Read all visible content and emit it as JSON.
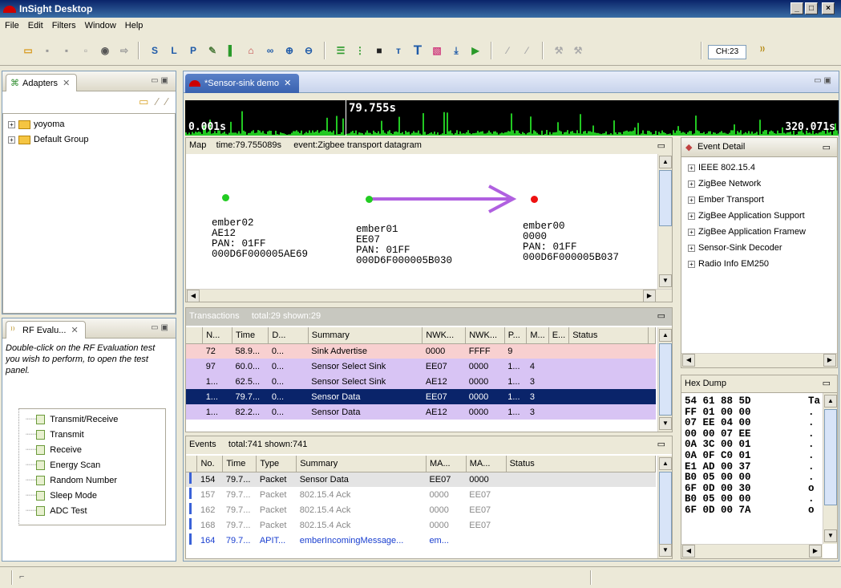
{
  "window": {
    "title": "InSight Desktop",
    "min": "_",
    "max": "□",
    "close": "×"
  },
  "menu": [
    "File",
    "Edit",
    "Filters",
    "Window",
    "Help"
  ],
  "toolbar": {
    "channel": "CH:23"
  },
  "adapters": {
    "tab": "Adapters",
    "items": [
      {
        "label": "yoyoma",
        "expander": "+"
      },
      {
        "label": "Default Group",
        "expander": "+"
      }
    ]
  },
  "rf_eval": {
    "tab": "RF Evalu...",
    "instructions": "Double-click on the RF Evaluation test you wish to perform, to open the test panel.",
    "tests": [
      "Transmit/Receive",
      "Transmit",
      "Receive",
      "Energy Scan",
      "Random Number",
      "Sleep Mode",
      "ADC Test"
    ]
  },
  "editor": {
    "tab": "*Sensor-sink demo",
    "timeline": {
      "cursor_time": "79.755s",
      "start": "0.001s",
      "end": "320.071s"
    }
  },
  "map": {
    "label": "Map",
    "time": "time:79.755089s",
    "event": "event:Zigbee transport datagram",
    "nodes": [
      {
        "name": "ember02",
        "short": "AE12",
        "pan": "PAN: 01FF",
        "eui": "000D6F000005AE69",
        "color": "#22cc22"
      },
      {
        "name": "ember01",
        "short": "EE07",
        "pan": "PAN: 01FF",
        "eui": "000D6F000005B030",
        "color": "#22cc22"
      },
      {
        "name": "ember00",
        "short": "0000",
        "pan": "PAN: 01FF",
        "eui": "000D6F000005B037",
        "color": "#ee1111"
      }
    ]
  },
  "transactions": {
    "title": "Transactions",
    "counts": "total:29 shown:29",
    "columns": [
      "N...",
      "Time",
      "D...",
      "Summary",
      "NWK...",
      "NWK...",
      "P...",
      "M...",
      "E...",
      "Status"
    ],
    "rows": [
      {
        "n": "72",
        "time": "58.9...",
        "d": "0...",
        "summary": "Sink Advertise",
        "nwk1": "0000",
        "nwk2": "FFFF",
        "p": "9",
        "m": "",
        "e": "",
        "status": "",
        "bg": "#f8d0d0",
        "fg": "#000"
      },
      {
        "n": "97",
        "time": "60.0...",
        "d": "0...",
        "summary": "Sensor Select Sink",
        "nwk1": "EE07",
        "nwk2": "0000",
        "p": "1...",
        "m": "4",
        "e": "",
        "status": "",
        "bg": "#d8c4f4",
        "fg": "#000"
      },
      {
        "n": "1...",
        "time": "62.5...",
        "d": "0...",
        "summary": "Sensor Select Sink",
        "nwk1": "AE12",
        "nwk2": "0000",
        "p": "1...",
        "m": "3",
        "e": "",
        "status": "",
        "bg": "#d8c4f4",
        "fg": "#000"
      },
      {
        "n": "1...",
        "time": "79.7...",
        "d": "0...",
        "summary": "Sensor Data",
        "nwk1": "EE07",
        "nwk2": "0000",
        "p": "1...",
        "m": "3",
        "e": "",
        "status": "",
        "bg": "#0a246a",
        "fg": "#fff"
      },
      {
        "n": "1...",
        "time": "82.2...",
        "d": "0...",
        "summary": "Sensor Data",
        "nwk1": "AE12",
        "nwk2": "0000",
        "p": "1...",
        "m": "3",
        "e": "",
        "status": "",
        "bg": "#d8c4f4",
        "fg": "#000"
      }
    ]
  },
  "events": {
    "title": "Events",
    "counts": "total:741 shown:741",
    "columns": [
      "No.",
      "Time",
      "Type",
      "Summary",
      "MA...",
      "MA...",
      "Status"
    ],
    "rows": [
      {
        "no": "154",
        "time": "79.7...",
        "type": "Packet",
        "summary": "Sensor Data",
        "ma1": "EE07",
        "ma2": "0000",
        "status": "",
        "fg": "#000",
        "bg": "#e4e4e4"
      },
      {
        "no": "157",
        "time": "79.7...",
        "type": "Packet",
        "summary": "802.15.4 Ack",
        "ma1": "0000",
        "ma2": "EE07",
        "status": "",
        "fg": "#888",
        "bg": "#fff"
      },
      {
        "no": "162",
        "time": "79.7...",
        "type": "Packet",
        "summary": "802.15.4 Ack",
        "ma1": "0000",
        "ma2": "EE07",
        "status": "",
        "fg": "#888",
        "bg": "#fff"
      },
      {
        "no": "168",
        "time": "79.7...",
        "type": "Packet",
        "summary": "802.15.4 Ack",
        "ma1": "0000",
        "ma2": "EE07",
        "status": "",
        "fg": "#888",
        "bg": "#fff"
      },
      {
        "no": "164",
        "time": "79.7...",
        "type": "APIT...",
        "summary": "emberIncomingMessage...",
        "ma1": "em...",
        "ma2": "",
        "status": "",
        "fg": "#1a3fd0",
        "bg": "#fff"
      }
    ]
  },
  "event_detail": {
    "tab": "Event Detail",
    "items": [
      "IEEE 802.15.4",
      "ZigBee Network",
      "Ember Transport",
      "ZigBee Application Support",
      "ZigBee Application Framew",
      "Sensor-Sink Decoder",
      "Radio Info EM250"
    ]
  },
  "hex_dump": {
    "tab": "Hex Dump",
    "lines": [
      "54 61 88 5D",
      "FF 01 00 00",
      "07 EE 04 00",
      "00 00 07 EE",
      "0A 3C 00 01",
      "0A 0F C0 01",
      "E1 AD 00 37",
      "B0 05 00 00",
      "6F 0D 00 30",
      "B0 05 00 00",
      "6F 0D 00 7A"
    ],
    "ascii": [
      "Ta",
      ".",
      ".",
      ".",
      ".",
      ".",
      ".",
      ".",
      "o",
      ".",
      "o"
    ]
  }
}
